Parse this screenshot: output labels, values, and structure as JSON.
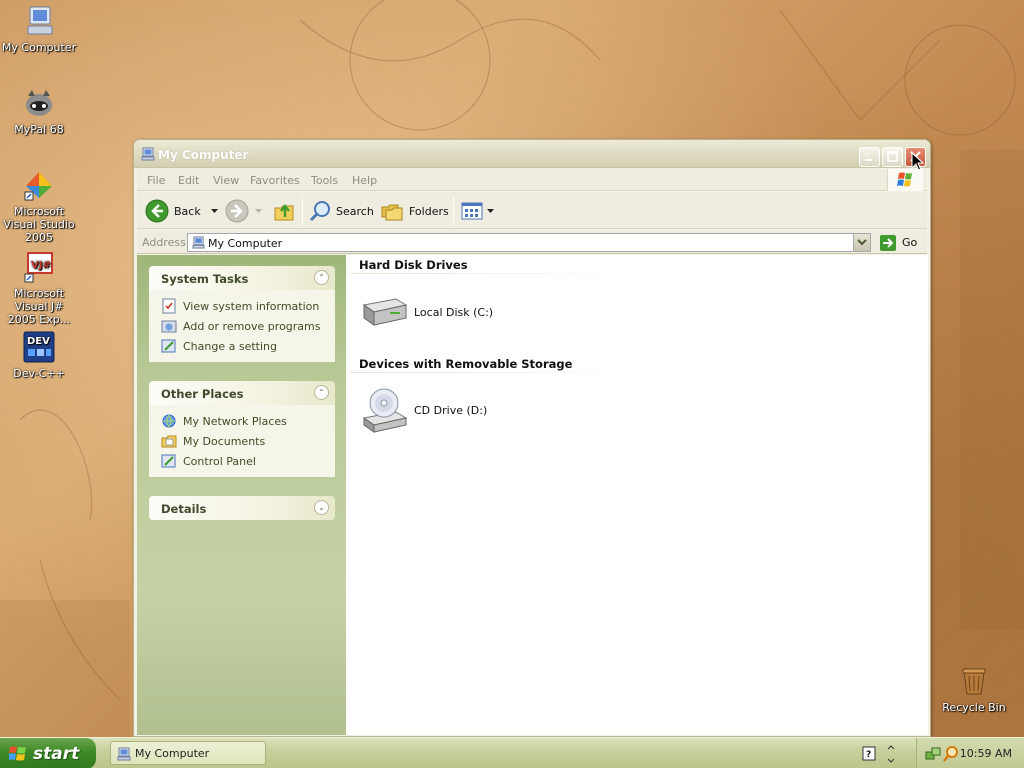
{
  "desktop": {
    "icons": [
      {
        "label": "My Computer",
        "icon": "my-computer-icon"
      },
      {
        "label": "MyPal 68",
        "icon": "raccoon-icon"
      },
      {
        "label": "Microsoft Visual Studio 2005",
        "icon": "visual-studio-icon"
      },
      {
        "label": "Microsoft Visual J# 2005 Exp...",
        "icon": "vj-icon"
      },
      {
        "label": "Dev-C++",
        "icon": "dev-cpp-icon"
      },
      {
        "label": "Recycle Bin",
        "icon": "recycle-bin-icon"
      }
    ]
  },
  "window": {
    "title": "My Computer",
    "menu": [
      "File",
      "Edit",
      "View",
      "Favorites",
      "Tools",
      "Help"
    ],
    "toolbar": {
      "back": "Back",
      "search": "Search",
      "folders": "Folders"
    },
    "address": {
      "label": "Address",
      "value": "My Computer",
      "go": "Go"
    },
    "taskpane": {
      "system_tasks": {
        "title": "System Tasks",
        "links": [
          "View system information",
          "Add or remove programs",
          "Change a setting"
        ]
      },
      "other_places": {
        "title": "Other Places",
        "links": [
          "My Network Places",
          "My Documents",
          "Control Panel"
        ]
      },
      "details": {
        "title": "Details"
      }
    },
    "content": {
      "groups": [
        {
          "title": "Hard Disk Drives",
          "items": [
            "Local Disk (C:)"
          ]
        },
        {
          "title": "Devices with Removable Storage",
          "items": [
            "CD Drive (D:)"
          ]
        }
      ]
    }
  },
  "taskbar": {
    "start_label": "start",
    "task_item": "My Computer",
    "clock": "10:59 AM"
  },
  "colors": {
    "taskpane_green": "#b8c996",
    "start_green": "#3d8a26",
    "close_red": "#c75a3f"
  }
}
